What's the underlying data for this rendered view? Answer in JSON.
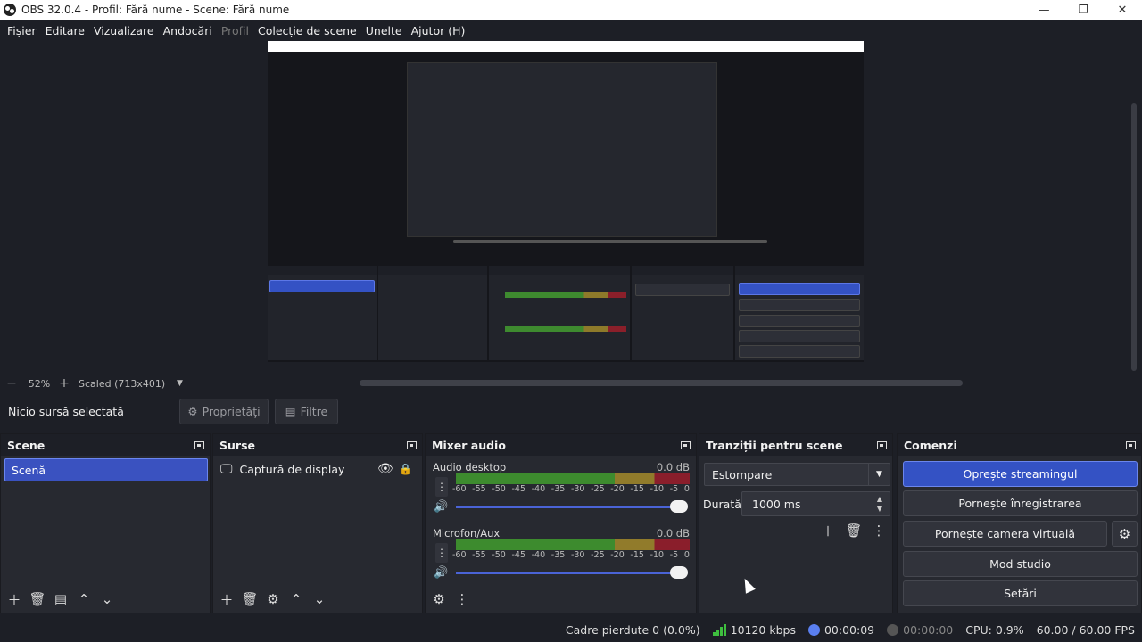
{
  "window": {
    "title": "OBS 32.0.4 - Profil: Fără nume - Scene: Fără nume"
  },
  "menu": [
    "Fișier",
    "Editare",
    "Vizualizare",
    "Andocări",
    "Profil",
    "Colecție de scene",
    "Unelte",
    "Ajutor (H)"
  ],
  "preview_bar": {
    "zoom": "52%",
    "scale_mode": "Scaled (713x401)"
  },
  "source_toolbar": {
    "no_source": "Nicio sursă selectată",
    "properties": "Proprietăți",
    "filters": "Filtre"
  },
  "scenes": {
    "title": "Scene",
    "items": [
      "Scenă"
    ]
  },
  "sources": {
    "title": "Surse",
    "items": [
      "Captură de display"
    ]
  },
  "mixer": {
    "title": "Mixer audio",
    "channels": [
      {
        "name": "Audio desktop",
        "level": "0.0 dB"
      },
      {
        "name": "Microfon/Aux",
        "level": "0.0 dB"
      }
    ],
    "ticks": [
      "-60",
      "-55",
      "-50",
      "-45",
      "-40",
      "-35",
      "-30",
      "-25",
      "-20",
      "-15",
      "-10",
      "-5",
      "0"
    ]
  },
  "transitions": {
    "title": "Tranziții pentru scene",
    "selected": "Estompare",
    "duration_label": "Durată",
    "duration_value": "1000 ms"
  },
  "controls": {
    "title": "Comenzi",
    "stop_stream": "Oprește streamingul",
    "start_record": "Pornește înregistrarea",
    "start_vcam": "Pornește camera virtuală",
    "studio_mode": "Mod studio",
    "settings": "Setări"
  },
  "status": {
    "dropped": "Cadre pierdute 0 (0.0%)",
    "bitrate": "10120 kbps",
    "stream_time": "00:00:09",
    "record_time": "00:00:00",
    "cpu": "CPU: 0.9%",
    "fps": "60.00 / 60.00 FPS"
  },
  "colors": {
    "accent": "#3452c4",
    "bitrate_green": "#3fbf3f",
    "live_blue": "#5a7ff0"
  }
}
